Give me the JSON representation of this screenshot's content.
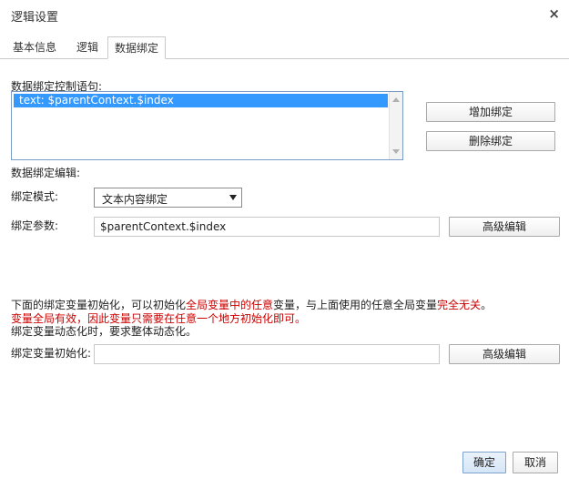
{
  "dialog": {
    "title": "逻辑设置",
    "close_glyph": "×"
  },
  "tabs": [
    {
      "label": "基本信息"
    },
    {
      "label": "逻辑"
    },
    {
      "label": "数据绑定"
    }
  ],
  "binding": {
    "control_label": "数据绑定控制语句:",
    "list_items": [
      "text: $parentContext.$index"
    ],
    "add_button": "增加绑定",
    "delete_button": "删除绑定",
    "edit_label": "数据绑定编辑:",
    "mode_label": "绑定模式:",
    "mode_value": "文本内容绑定",
    "param_label": "绑定参数:",
    "param_value": "$parentContext.$index",
    "advanced_button": "高级编辑"
  },
  "info": {
    "line1_a": "下面的绑定变量初始化，可以初始化",
    "line1_b": "全局变量中的任意",
    "line1_c": "变量，与上面使用的任意全局变量",
    "line1_d": "完全无关",
    "line1_e": "。",
    "line2": "变量全局有效，因此变量只需要在任意一个地方初始化即可。",
    "line3": "绑定变量动态化时，要求整体动态化。"
  },
  "init": {
    "label": "绑定变量初始化:",
    "value": "",
    "advanced_button": "高级编辑"
  },
  "footer": {
    "ok": "确定",
    "cancel": "取消"
  }
}
